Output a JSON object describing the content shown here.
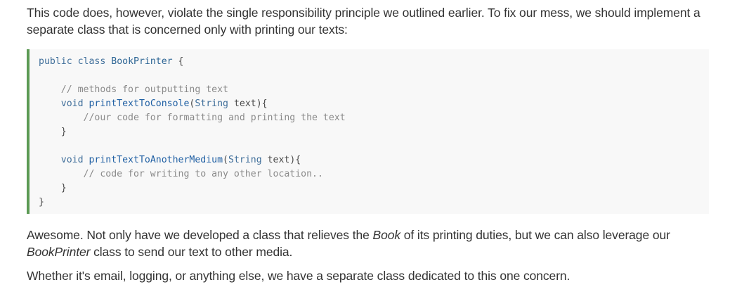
{
  "paragraphs": {
    "intro": "This code does, however, violate the single responsibility principle we outlined earlier. To fix our mess, we should implement a separate class that is concerned only with printing our texts:",
    "awesome_pre": "Awesome. Not only have we developed a class that relieves the ",
    "awesome_em1": "Book",
    "awesome_mid": " of its printing duties, but we can also leverage our ",
    "awesome_em2": "BookPrinter",
    "awesome_post": " class to send our text to other media.",
    "closing": "Whether it's email, logging, or anything else, we have a separate class dedicated to this one concern."
  },
  "code": {
    "l1_kw1": "public",
    "l1_kw2": "class",
    "l1_name": "BookPrinter",
    "l1_brace": " {",
    "l3_comment": "// methods for outputting text",
    "l4_type": "void",
    "l4_fn": "printTextToConsole",
    "l4_open": "(",
    "l4_ptype": "String",
    "l4_param": " text){",
    "l5_comment": "//our code for formatting and printing the text",
    "l6_close": "}",
    "l8_type": "void",
    "l8_fn": "printTextToAnotherMedium",
    "l8_open": "(",
    "l8_ptype": "String",
    "l8_param": " text){",
    "l9_comment": "// code for writing to any other location..",
    "l10_close": "}",
    "l11_close": "}"
  }
}
